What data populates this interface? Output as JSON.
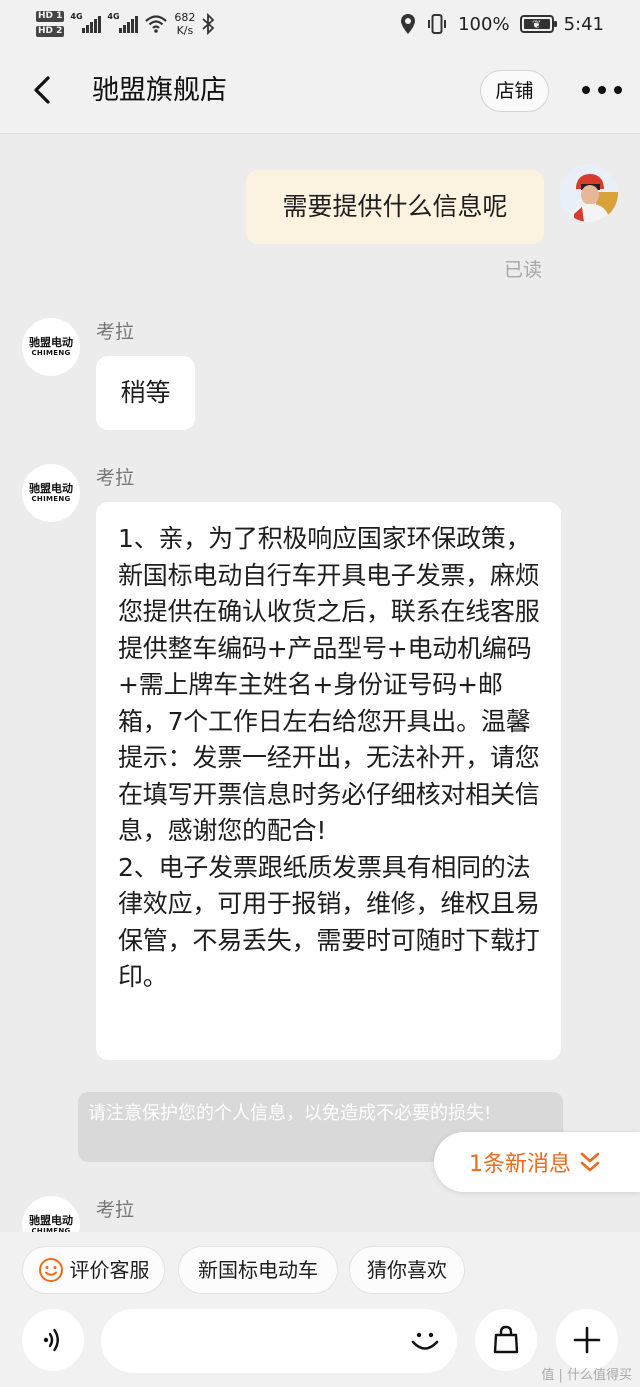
{
  "status_bar": {
    "hd1": "HD 1",
    "hd2": "HD 2",
    "net1": "4G",
    "net2": "4G",
    "speed_value": "682",
    "speed_unit": "K/s",
    "battery_percent": "100%",
    "time": "5:41"
  },
  "header": {
    "title": "驰盟旗舰店",
    "shop_button": "店铺"
  },
  "messages": {
    "user_message": "需要提供什么信息呢",
    "read_status": "已读",
    "shop_avatar_cn": "驰盟电动",
    "shop_avatar_en": "CHIMENG",
    "sender_name": "考拉",
    "reply_wait": "稍等",
    "reply_long": "1、亲，为了积极响应国家环保政策，新国标电动自行车开具电子发票，麻烦您提供在确认收货之后，联系在线客服提供整车编码+产品型号+电动机编码+需上牌车主姓名+身份证号码+邮箱，7个工作日左右给您开具出。温馨提示：发票一经开出，无法补开，请您在填写开票信息时务必仔细核对相关信息，感谢您的配合!\n2、电子发票跟纸质发票具有相同的法律效应，可用于报销，维修，维权且易保管，不易丢失，需要时可随时下载打印。",
    "privacy_tip": "请注意保护您的个人信息，以免造成不必要的损失!",
    "new_message_pill": "1条新消息"
  },
  "quick_actions": [
    "评价客服",
    "新国标电动车",
    "猜你喜欢"
  ],
  "watermark": "值 | 什么值得买",
  "colors": {
    "accent": "#ef6a19",
    "user_bubble": "#fcf2e0",
    "background": "#ececec"
  }
}
